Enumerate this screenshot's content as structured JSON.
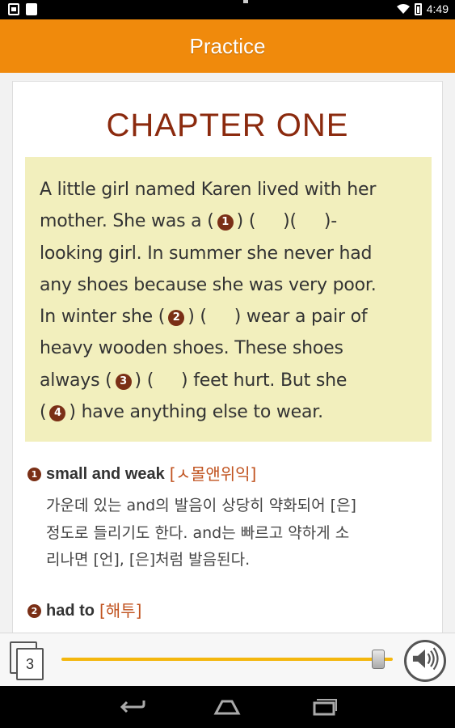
{
  "status_bar": {
    "time": "4:49",
    "icons": [
      "image-icon",
      "sd-card-icon",
      "wifi-icon",
      "battery-icon"
    ]
  },
  "app_bar": {
    "title": "Practice"
  },
  "chapter": {
    "title": "CHAPTER ONE",
    "passage_lines": [
      "  A little girl named Karen lived with her",
      "mother. She was a ( {1} ) (      )(      )-",
      "looking girl. In summer she never had",
      "any shoes because she was very poor.",
      "In winter she ( {2} ) (      ) wear a pair of",
      "heavy wooden shoes. These shoes",
      "always ( {3} ) (      ) feet hurt. But she",
      "( {4} ) have anything else to wear."
    ]
  },
  "notes": [
    {
      "number": "1",
      "term": "small and weak",
      "pronunciation": "[ㅅ몰앤위익]",
      "body_lines": [
        "가운데 있는 and의 발음이 상당히 약화되어 [은]",
        "정도로 들리기도 한다. and는 빠르고 약하게 소",
        "리나면 [언], [은]처럼 발음된다."
      ]
    },
    {
      "number": "2",
      "term": "had to",
      "pronunciation": "[해투]",
      "body_lines": []
    }
  ],
  "player": {
    "page_number": "3",
    "progress": 0.975,
    "accent_color": "#f4b70e",
    "audio_icon": "speaker-icon"
  },
  "colors": {
    "app_bar": "#f08a0c",
    "chapter_title": "#8b2a0e",
    "passage_bg": "#f2efbd",
    "marker": "#7a2f16",
    "pronunciation": "#c0521e"
  },
  "nav": {
    "icons": [
      "back-icon",
      "home-icon",
      "recent-apps-icon"
    ]
  }
}
